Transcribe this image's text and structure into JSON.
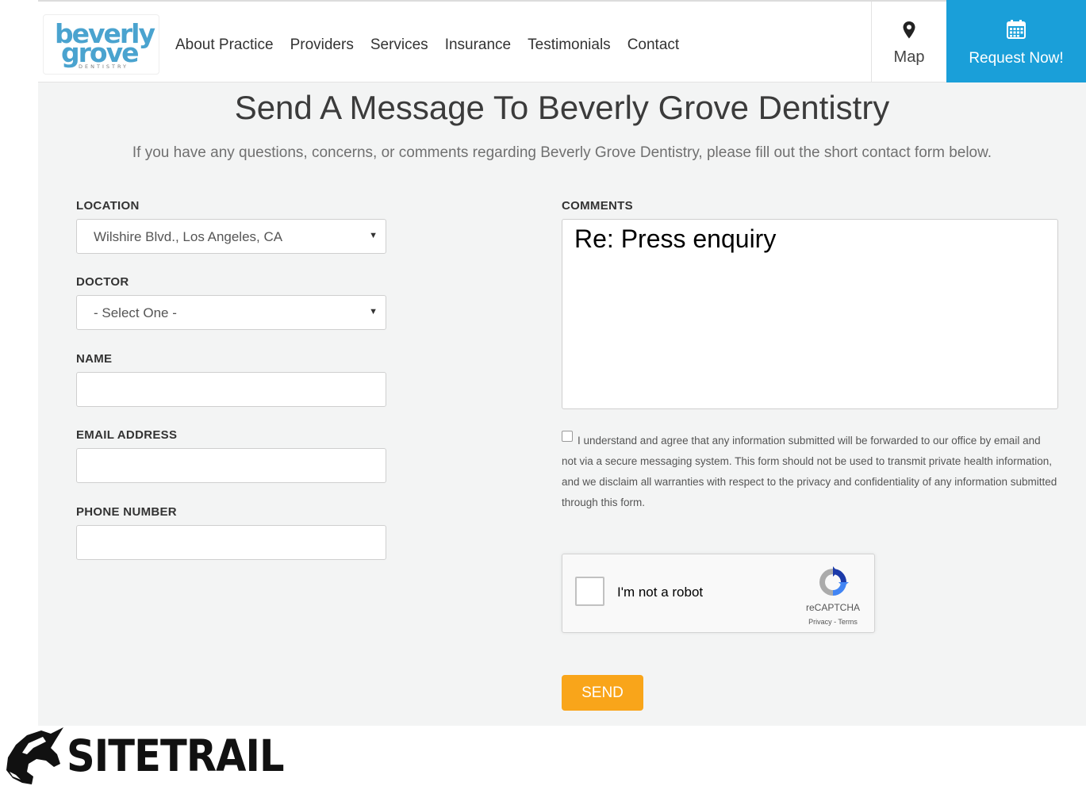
{
  "brand": {
    "logo_line1": "beverly",
    "logo_line2": "grove",
    "logo_line3": "DENTISTRY"
  },
  "nav": {
    "items": [
      "About Practice",
      "Providers",
      "Services",
      "Insurance",
      "Testimonials",
      "Contact"
    ]
  },
  "header": {
    "map_label": "Map",
    "request_label": "Request Now!"
  },
  "page": {
    "title": "Send A Message To Beverly Grove Dentistry",
    "subtitle": "If you have any questions, concerns, or comments regarding Beverly Grove Dentistry, please fill out the short contact form below."
  },
  "form": {
    "location_label": "LOCATION",
    "location_value": "Wilshire Blvd., Los Angeles, CA",
    "doctor_label": "DOCTOR",
    "doctor_value": "- Select One -",
    "name_label": "NAME",
    "name_value": "",
    "email_label": "EMAIL ADDRESS",
    "email_value": "",
    "phone_label": "PHONE NUMBER",
    "phone_value": "",
    "comments_label": "COMMENTS",
    "comments_value": "Re: Press enquiry",
    "agree_text": "I understand and agree that any information submitted will be forwarded to our office by email and not via a secure messaging system. This form should not be used to transmit private health information, and we disclaim all warranties with respect to the privacy and confidentiality of any information submitted through this form.",
    "agree_checked": false,
    "send_label": "SEND"
  },
  "recaptcha": {
    "label": "I'm not a robot",
    "brand": "reCAPTCHA",
    "links": "Privacy - Terms"
  },
  "watermark": {
    "text": "SITETRAIL"
  },
  "colors": {
    "accent_blue": "#1a9fd9",
    "send_orange": "#f9a51a",
    "logo_blue": "#4aa3cf",
    "background": "#f3f4f4"
  },
  "icons": [
    "map-pin-icon",
    "calendar-icon",
    "dropdown-caret-icon",
    "recaptcha-icon",
    "horse-head-icon"
  ]
}
